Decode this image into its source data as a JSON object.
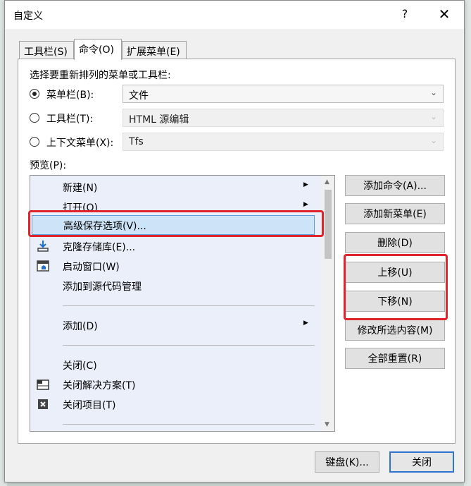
{
  "dialog": {
    "title": "自定义",
    "help_label": "?",
    "close_label": "✕"
  },
  "tabs": [
    {
      "label": "工具栏(S)",
      "active": false
    },
    {
      "label": "命令(O)",
      "active": true
    },
    {
      "label": "扩展菜单(E)",
      "active": false
    }
  ],
  "panel": {
    "instruction": "选择要重新排列的菜单或工具栏:",
    "options": [
      {
        "label": "菜单栏(B):",
        "selected": true,
        "value": "文件",
        "enabled": true
      },
      {
        "label": "工具栏(T):",
        "selected": false,
        "value": "HTML 源编辑",
        "enabled": false
      },
      {
        "label": "上下文菜单(X):",
        "selected": false,
        "value": "Tfs",
        "enabled": false
      }
    ],
    "preview_label": "预览(P):",
    "menu_items": [
      {
        "label": "新建(N)",
        "submenu": true,
        "icon": ""
      },
      {
        "label": "打开(O)",
        "submenu": true,
        "icon": ""
      },
      {
        "label": "高级保存选项(V)...",
        "submenu": false,
        "icon": "",
        "selected": true
      },
      {
        "label": "克隆存储库(E)...",
        "submenu": false,
        "icon": "clone-repo-icon"
      },
      {
        "label": "启动窗口(W)",
        "submenu": false,
        "icon": "start-window-icon"
      },
      {
        "label": "添加到源代码管理",
        "submenu": false,
        "icon": ""
      },
      {
        "label": "添加(D)",
        "submenu": true,
        "icon": ""
      },
      {
        "label": "关闭(C)",
        "submenu": false,
        "icon": ""
      },
      {
        "label": "关闭解决方案(T)",
        "submenu": false,
        "icon": "close-solution-icon"
      },
      {
        "label": "关闭项目(T)",
        "submenu": false,
        "icon": "close-project-icon"
      }
    ],
    "buttons": {
      "add_command": "添加命令(A)...",
      "add_menu": "添加新菜单(E)",
      "delete": "删除(D)",
      "move_up": "上移(U)",
      "move_down": "下移(N)",
      "modify": "修改所选内容(M)",
      "reset_all": "全部重置(R)"
    }
  },
  "footer": {
    "keyboard": "键盘(K)...",
    "close": "关闭"
  },
  "colors": {
    "highlight": "#e0242c",
    "accent": "#2f74d0",
    "selection": "#cde3f7"
  }
}
